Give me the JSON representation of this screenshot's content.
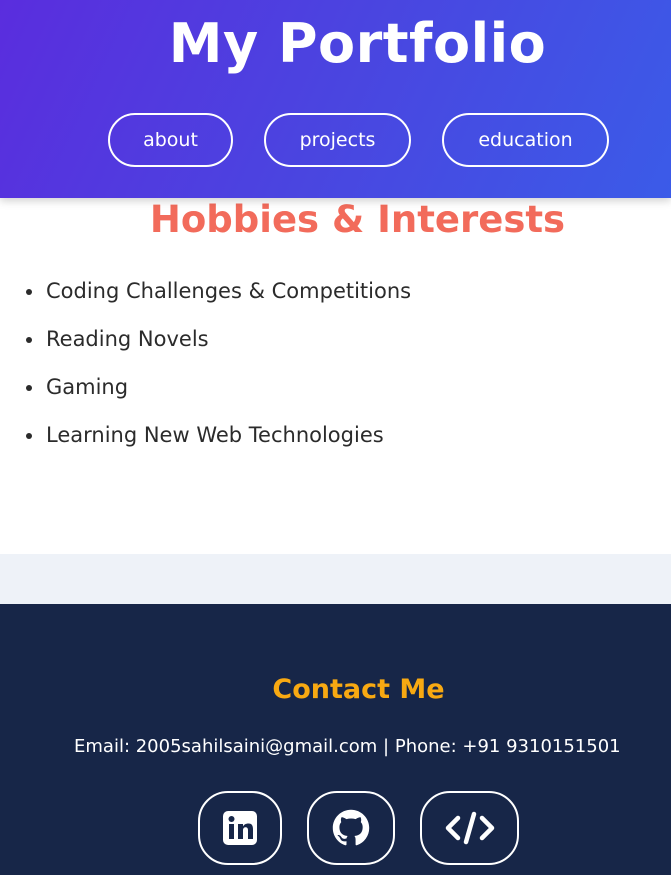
{
  "header": {
    "title": "My Portfolio",
    "nav": [
      {
        "label": "about"
      },
      {
        "label": "projects"
      },
      {
        "label": "education"
      }
    ]
  },
  "hobbies": {
    "title": "Hobbies & Interests",
    "items": [
      "Coding Challenges & Competitions",
      "Reading Novels",
      "Gaming",
      "Learning New Web Technologies"
    ]
  },
  "contact": {
    "title": "Contact Me",
    "line": "Email: 2005sahilsaini@gmail.com | Phone: +91 9310151501",
    "social_icons": [
      "linkedin-icon",
      "github-icon",
      "code-icon"
    ]
  },
  "colors": {
    "header_gradient_start": "#5a2dde",
    "header_gradient_end": "#3b5be8",
    "hobbies_title": "#f26b5b",
    "contact_bg": "#172648",
    "contact_title": "#f8a912"
  }
}
